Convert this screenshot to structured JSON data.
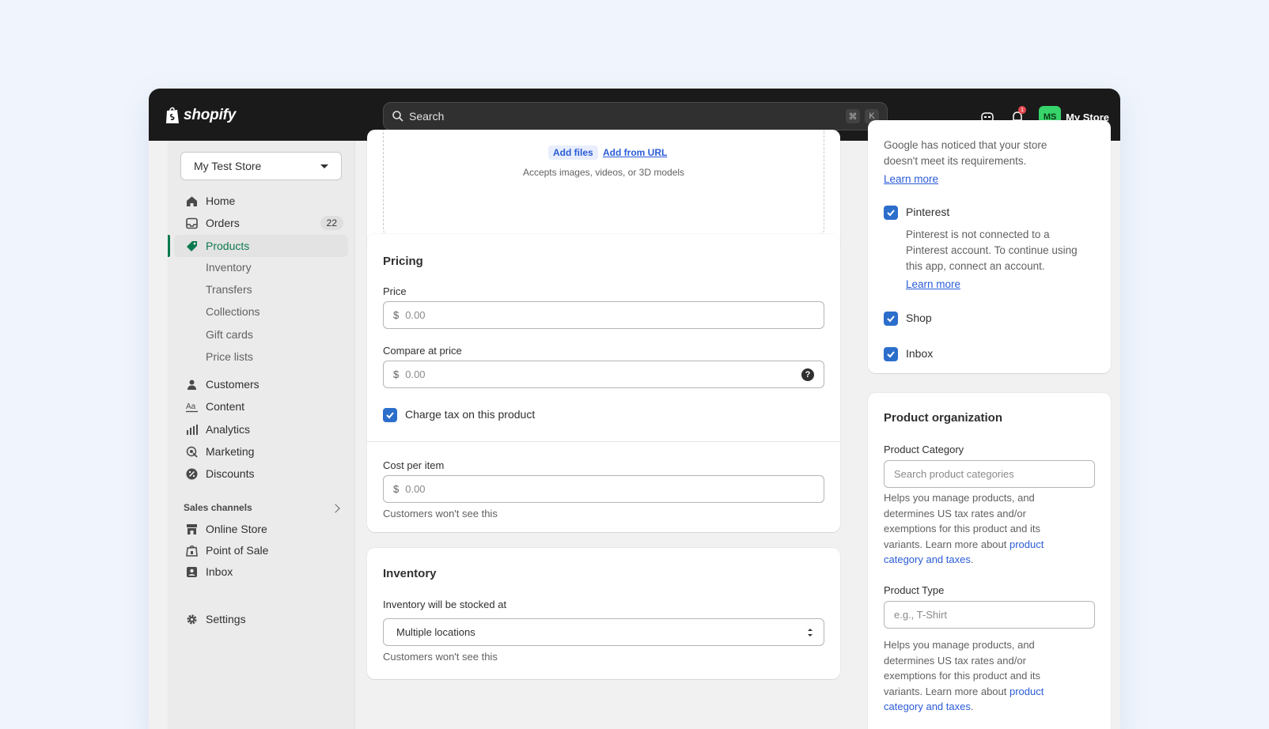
{
  "topbar": {
    "brand": "shopify",
    "search_placeholder": "Search",
    "shortcut_keys": [
      "⌘",
      "K"
    ],
    "notification_count": "1",
    "avatar_initials": "MS",
    "store_name": "My Store"
  },
  "sidebar": {
    "store_selector": "My Test Store",
    "items": [
      {
        "label": "Home",
        "icon": "home-icon"
      },
      {
        "label": "Orders",
        "icon": "inbox-tray-icon",
        "badge": "22"
      },
      {
        "label": "Products",
        "icon": "tag-icon",
        "active": true
      },
      {
        "label": "Customers",
        "icon": "person-icon"
      },
      {
        "label": "Content",
        "icon": "text-icon"
      },
      {
        "label": "Analytics",
        "icon": "bar-chart-icon"
      },
      {
        "label": "Marketing",
        "icon": "target-icon"
      },
      {
        "label": "Discounts",
        "icon": "percent-icon"
      }
    ],
    "product_sub_items": [
      "Inventory",
      "Transfers",
      "Collections",
      "Gift cards",
      "Price lists"
    ],
    "sales_channels_label": "Sales channels",
    "channels": [
      {
        "label": "Online Store",
        "icon": "storefront-icon"
      },
      {
        "label": "Point of Sale",
        "icon": "pos-bag-icon"
      },
      {
        "label": "Inbox",
        "icon": "chat-inbox-icon"
      }
    ],
    "settings_label": "Settings"
  },
  "media": {
    "add_files": "Add files",
    "add_from_url": "Add from URL",
    "accepts": "Accepts images, videos, or 3D models"
  },
  "pricing": {
    "title": "Pricing",
    "price_label": "Price",
    "price_currency": "$",
    "price_placeholder": "0.00",
    "compare_label": "Compare at price",
    "compare_currency": "$",
    "compare_placeholder": "0.00",
    "charge_tax_label": "Charge tax on this product",
    "charge_tax_checked": true,
    "cost_label": "Cost per item",
    "cost_currency": "$",
    "cost_placeholder": "0.00",
    "cost_help": "Customers won't see this"
  },
  "inventory": {
    "title": "Inventory",
    "stocked_label": "Inventory will be stocked at",
    "stocked_value": "Multiple locations",
    "help": "Customers won't see this"
  },
  "channels_panel": {
    "google_text_line1": "Google has noticed that your store",
    "google_text_line2": "doesn't meet its requirements.",
    "learn_more_1": "Learn more",
    "pinterest_label": "Pinterest",
    "pinterest_text_line1": "Pinterest is not connected to a",
    "pinterest_text_line2": "Pinterest account. To continue using",
    "pinterest_text_line3": "this app, connect an account.",
    "learn_more_2": "Learn more",
    "shop_label": "Shop",
    "inbox_label": "Inbox"
  },
  "organization": {
    "title": "Product organization",
    "category_label": "Product Category",
    "category_placeholder": "Search product categories",
    "category_help_1": "Helps you manage products, and",
    "category_help_2": "determines US tax rates and/or",
    "category_help_3": "exemptions for this product and its",
    "category_help_4": "variants. Learn more about ",
    "category_help_link_a": "product",
    "category_help_link_b": "category and taxes",
    "type_label": "Product Type",
    "type_placeholder": "e.g., T-Shirt",
    "type_help_1": "Helps you manage products, and",
    "type_help_2": "determines US tax rates and/or",
    "type_help_3": "exemptions for this product and its",
    "type_help_4": "variants. Learn more about ",
    "type_help_link_a": "product",
    "type_help_link_b": "category and taxes"
  },
  "colors": {
    "topbar": "#1a1a1a",
    "active_green": "#0c7a4e",
    "checkbox_blue": "#2c6ecb",
    "link_blue": "#2a5bd7",
    "avatar_green": "#36d46a"
  }
}
